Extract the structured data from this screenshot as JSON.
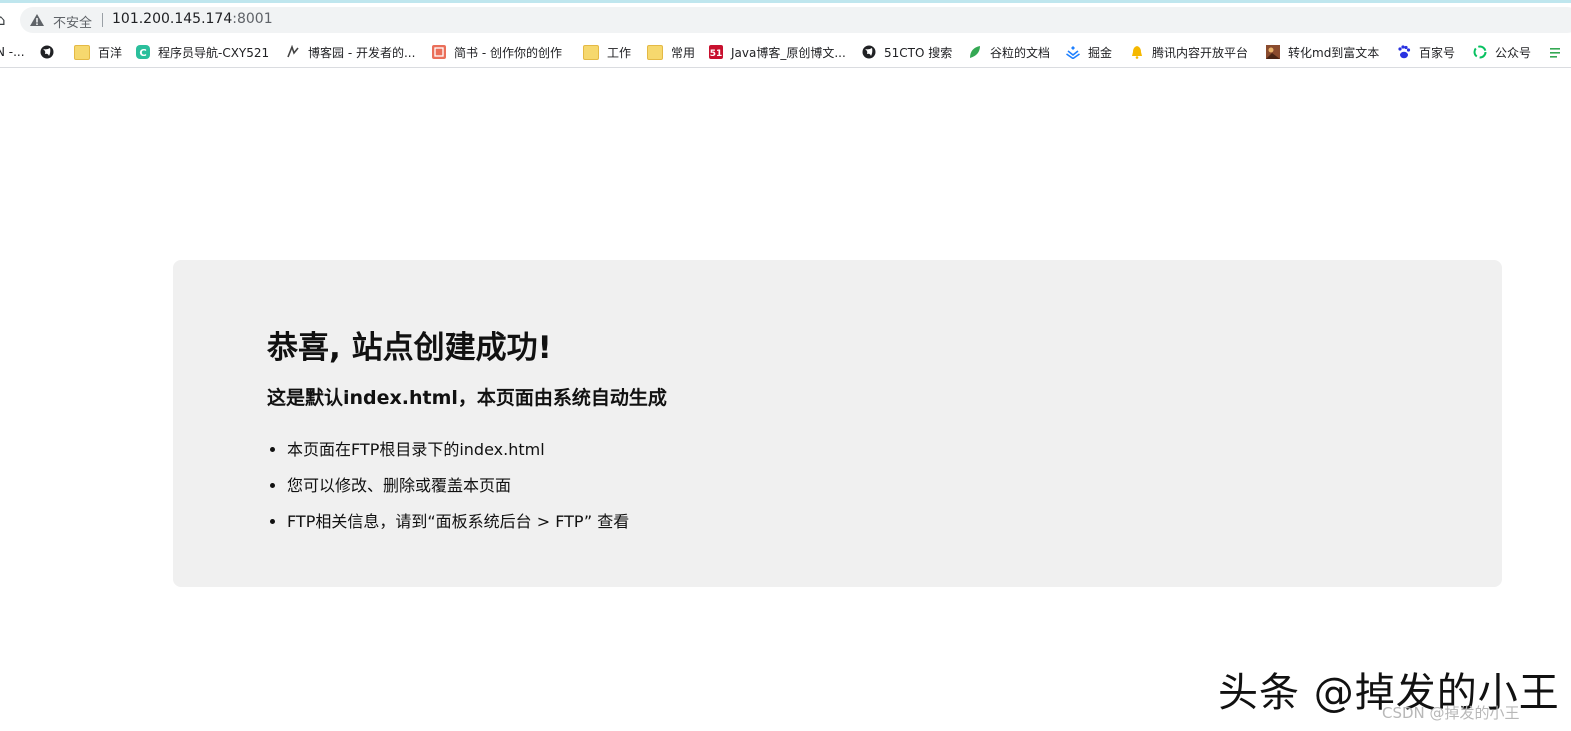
{
  "browser": {
    "security_label": "不安全",
    "url_host": "101.200.145.174",
    "url_port": ":8001"
  },
  "bookmarks": [
    {
      "label": "N -...",
      "icon": "partial-bookmark"
    },
    {
      "label": "",
      "icon": "globe-icon"
    },
    {
      "label": "百洋",
      "icon": "folder-icon"
    },
    {
      "label": "程序员导航-CXY521",
      "icon": "cxy-logo-icon"
    },
    {
      "label": "博客园 - 开发者的...",
      "icon": "cnblogs-icon"
    },
    {
      "label": "简书 - 创作你的创作",
      "icon": "jianshu-icon"
    },
    {
      "label": "工作",
      "icon": "folder-icon"
    },
    {
      "label": "常用",
      "icon": "folder-icon"
    },
    {
      "label": "Java博客_原创博文...",
      "icon": "51cto-icon"
    },
    {
      "label": "51CTO 搜索",
      "icon": "globe-icon"
    },
    {
      "label": "谷粒的文档",
      "icon": "leaf-icon"
    },
    {
      "label": "掘金",
      "icon": "juejin-icon"
    },
    {
      "label": "腾讯内容开放平台",
      "icon": "bell-icon"
    },
    {
      "label": "转化md到富文本",
      "icon": "image-icon"
    },
    {
      "label": "百家号",
      "icon": "baidu-paw-icon"
    },
    {
      "label": "公众号",
      "icon": "recycle-icon"
    }
  ],
  "content": {
    "title": "恭喜, 站点创建成功!",
    "subtitle": "这是默认index.html，本页面由系统自动生成",
    "items": [
      "本页面在FTP根目录下的index.html",
      "您可以修改、删除或覆盖本页面",
      "FTP相关信息，请到“面板系统后台 > FTP” 查看"
    ]
  },
  "watermark": {
    "main": "头条 @掉发的小王",
    "sub": "CSDN @掉发的小王"
  },
  "colors": {
    "card_bg": "#f0f0f0",
    "omnibox_bg": "#f1f3f4",
    "text": "#111111"
  }
}
